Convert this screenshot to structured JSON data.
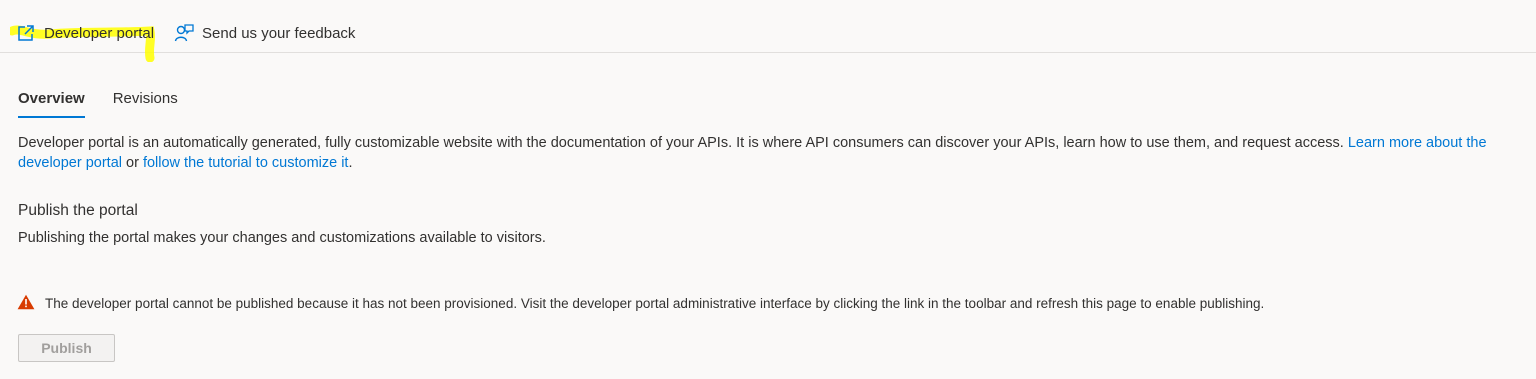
{
  "toolbar": {
    "developer_portal_label": "Developer portal",
    "feedback_label": "Send us your feedback"
  },
  "tabs": [
    {
      "label": "Overview",
      "active": true
    },
    {
      "label": "Revisions",
      "active": false
    }
  ],
  "description": {
    "text_part1": "Developer portal is an automatically generated, fully customizable website with the documentation of your APIs. It is where API consumers can discover your APIs, learn how to use them, and request access. ",
    "link1": "Learn more about the developer portal",
    "text_part2": " or ",
    "link2": "follow the tutorial to customize it",
    "text_part3": "."
  },
  "publish_section": {
    "title": "Publish the portal",
    "subtitle": "Publishing the portal makes your changes and customizations available to visitors."
  },
  "warning": {
    "icon": "warning-icon",
    "text": "The developer portal cannot be published because it has not been provisioned. Visit the developer portal administrative interface by clicking the link in the toolbar and refresh this page to enable publishing."
  },
  "publish_button": {
    "label": "Publish",
    "disabled": true
  },
  "colors": {
    "accent": "#0078d4",
    "warning": "#d83b01",
    "highlight": "#ffff00"
  }
}
